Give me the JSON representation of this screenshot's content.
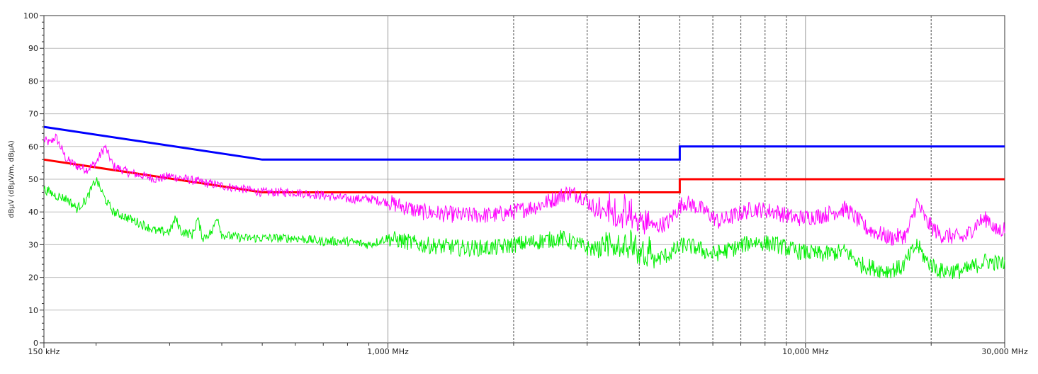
{
  "chart_data": {
    "type": "line",
    "title": "",
    "xlabel": "",
    "ylabel": "dBµV  (dBµV/m, dBµA)",
    "x_scale": "log",
    "xlim": [
      0.15,
      30
    ],
    "ylim": [
      0,
      100
    ],
    "grid": true,
    "y_ticks": [
      0,
      10,
      20,
      30,
      40,
      50,
      60,
      70,
      80,
      90,
      100
    ],
    "y_tick_labels": [
      "0",
      "10",
      "20",
      "30",
      "40",
      "50",
      "60",
      "70",
      "80",
      "90",
      "100"
    ],
    "x_tick_labels": [
      {
        "x": 0.15,
        "label": "150 kHz"
      },
      {
        "x": 1,
        "label": "1,000 MHz"
      },
      {
        "x": 10,
        "label": "10,000 MHz"
      },
      {
        "x": 30,
        "label": "30,000 MHz"
      }
    ],
    "x_major_grid": [
      1,
      10
    ],
    "x_minor_grid": [
      2,
      3,
      4,
      5,
      6,
      7,
      8,
      9,
      20
    ],
    "series": [
      {
        "color": "#0000ff",
        "step": false,
        "points": [
          [
            0.15,
            66
          ],
          [
            0.5,
            56
          ],
          [
            5,
            56
          ],
          [
            5,
            60
          ],
          [
            30,
            60
          ]
        ]
      },
      {
        "color": "#ff0000",
        "step": false,
        "points": [
          [
            0.15,
            56
          ],
          [
            0.5,
            46
          ],
          [
            5,
            46
          ],
          [
            5,
            50
          ],
          [
            30,
            50
          ]
        ]
      },
      {
        "color": "#ff00ff",
        "noisy": true,
        "points": [
          [
            0.15,
            62
          ],
          [
            0.155,
            61
          ],
          [
            0.16,
            63
          ],
          [
            0.17,
            56
          ],
          [
            0.18,
            54
          ],
          [
            0.19,
            53
          ],
          [
            0.2,
            55
          ],
          [
            0.21,
            60
          ],
          [
            0.22,
            54
          ],
          [
            0.24,
            52
          ],
          [
            0.26,
            51
          ],
          [
            0.28,
            50
          ],
          [
            0.3,
            51
          ],
          [
            0.33,
            50
          ],
          [
            0.36,
            49
          ],
          [
            0.4,
            48
          ],
          [
            0.45,
            47
          ],
          [
            0.5,
            46
          ],
          [
            0.6,
            46
          ],
          [
            0.7,
            45
          ],
          [
            0.8,
            44
          ],
          [
            0.9,
            44
          ],
          [
            1.0,
            43
          ],
          [
            1.2,
            40
          ],
          [
            1.5,
            39
          ],
          [
            1.8,
            39
          ],
          [
            2.0,
            40
          ],
          [
            2.3,
            42
          ],
          [
            2.5,
            44
          ],
          [
            2.7,
            46
          ],
          [
            2.9,
            45
          ],
          [
            3.2,
            40
          ],
          [
            3.5,
            38
          ],
          [
            4.0,
            36
          ],
          [
            4.3,
            35
          ],
          [
            4.7,
            37
          ],
          [
            5.1,
            43
          ],
          [
            5.4,
            42
          ],
          [
            5.8,
            40
          ],
          [
            6.2,
            37
          ],
          [
            6.8,
            39
          ],
          [
            7.5,
            41
          ],
          [
            8.5,
            40
          ],
          [
            9.5,
            38
          ],
          [
            11,
            39
          ],
          [
            12.5,
            41
          ],
          [
            14,
            35
          ],
          [
            16,
            32
          ],
          [
            17.5,
            33
          ],
          [
            18.5,
            43
          ],
          [
            19.5,
            37
          ],
          [
            21,
            33
          ],
          [
            24,
            32
          ],
          [
            26,
            37
          ],
          [
            27.5,
            38
          ],
          [
            28.5,
            34
          ],
          [
            30,
            35
          ]
        ]
      },
      {
        "color": "#00ee00",
        "noisy": true,
        "points": [
          [
            0.15,
            47
          ],
          [
            0.16,
            45
          ],
          [
            0.17,
            44
          ],
          [
            0.18,
            41
          ],
          [
            0.19,
            44
          ],
          [
            0.2,
            50
          ],
          [
            0.21,
            44
          ],
          [
            0.22,
            40
          ],
          [
            0.24,
            38
          ],
          [
            0.26,
            36
          ],
          [
            0.28,
            34
          ],
          [
            0.3,
            34
          ],
          [
            0.31,
            38
          ],
          [
            0.32,
            34
          ],
          [
            0.34,
            33
          ],
          [
            0.35,
            38
          ],
          [
            0.36,
            32
          ],
          [
            0.38,
            34
          ],
          [
            0.39,
            39
          ],
          [
            0.4,
            33
          ],
          [
            0.45,
            32
          ],
          [
            0.5,
            32
          ],
          [
            0.6,
            32
          ],
          [
            0.7,
            31
          ],
          [
            0.8,
            31
          ],
          [
            0.9,
            30
          ],
          [
            1.0,
            32
          ],
          [
            1.2,
            30
          ],
          [
            1.5,
            29
          ],
          [
            1.8,
            29
          ],
          [
            2.0,
            30
          ],
          [
            2.3,
            31
          ],
          [
            2.6,
            32
          ],
          [
            3.0,
            29
          ],
          [
            3.4,
            28
          ],
          [
            3.8,
            27
          ],
          [
            4.3,
            25
          ],
          [
            4.7,
            27
          ],
          [
            5.1,
            30
          ],
          [
            5.5,
            29
          ],
          [
            6.0,
            27
          ],
          [
            6.8,
            29
          ],
          [
            7.5,
            31
          ],
          [
            8.5,
            30
          ],
          [
            9.5,
            28
          ],
          [
            11,
            27
          ],
          [
            12.5,
            28
          ],
          [
            13.5,
            24
          ],
          [
            15.5,
            22
          ],
          [
            17,
            23
          ],
          [
            18.5,
            30
          ],
          [
            19.5,
            25
          ],
          [
            21,
            22
          ],
          [
            24,
            22
          ],
          [
            27,
            25
          ],
          [
            30,
            24
          ]
        ]
      }
    ]
  }
}
